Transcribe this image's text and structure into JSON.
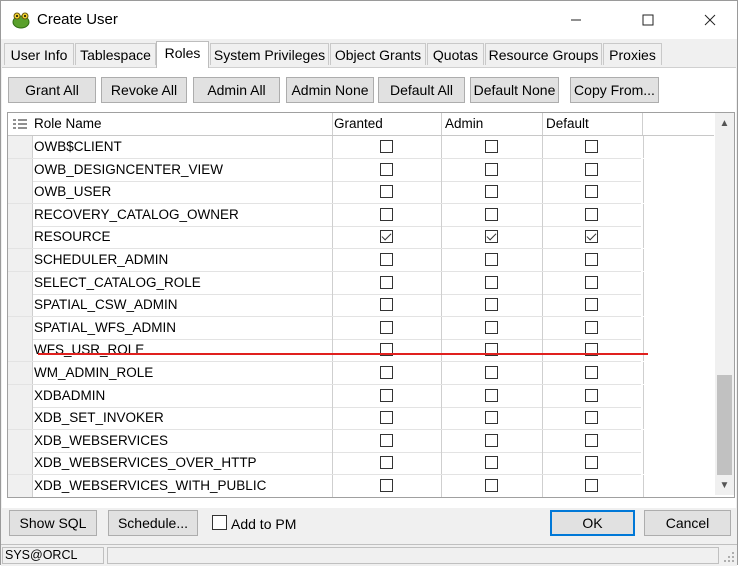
{
  "window": {
    "title": "Create User"
  },
  "tabs": [
    {
      "label": "User Info"
    },
    {
      "label": "Tablespace"
    },
    {
      "label": "Roles"
    },
    {
      "label": "System Privileges"
    },
    {
      "label": "Object Grants"
    },
    {
      "label": "Quotas"
    },
    {
      "label": "Resource Groups"
    },
    {
      "label": "Proxies"
    }
  ],
  "active_tab": "Roles",
  "toolbar": {
    "grant_all": "Grant All",
    "revoke_all": "Revoke All",
    "admin_all": "Admin All",
    "admin_none": "Admin None",
    "default_all": "Default All",
    "default_none": "Default None",
    "copy_from": "Copy From..."
  },
  "grid": {
    "headers": {
      "role_name": "Role Name",
      "granted": "Granted",
      "admin": "Admin",
      "default": "Default"
    },
    "rows": [
      {
        "name": "OWB$CLIENT",
        "granted": false,
        "admin": false,
        "default": false
      },
      {
        "name": "OWB_DESIGNCENTER_VIEW",
        "granted": false,
        "admin": false,
        "default": false
      },
      {
        "name": "OWB_USER",
        "granted": false,
        "admin": false,
        "default": false
      },
      {
        "name": "RECOVERY_CATALOG_OWNER",
        "granted": false,
        "admin": false,
        "default": false
      },
      {
        "name": "RESOURCE",
        "granted": true,
        "admin": true,
        "default": true
      },
      {
        "name": "SCHEDULER_ADMIN",
        "granted": false,
        "admin": false,
        "default": false
      },
      {
        "name": "SELECT_CATALOG_ROLE",
        "granted": false,
        "admin": false,
        "default": false
      },
      {
        "name": "SPATIAL_CSW_ADMIN",
        "granted": false,
        "admin": false,
        "default": false
      },
      {
        "name": "SPATIAL_WFS_ADMIN",
        "granted": false,
        "admin": false,
        "default": false
      },
      {
        "name": "WFS_USR_ROLE",
        "granted": false,
        "admin": false,
        "default": false
      },
      {
        "name": "WM_ADMIN_ROLE",
        "granted": false,
        "admin": false,
        "default": false
      },
      {
        "name": "XDBADMIN",
        "granted": false,
        "admin": false,
        "default": false
      },
      {
        "name": "XDB_SET_INVOKER",
        "granted": false,
        "admin": false,
        "default": false
      },
      {
        "name": "XDB_WEBSERVICES",
        "granted": false,
        "admin": false,
        "default": false
      },
      {
        "name": "XDB_WEBSERVICES_OVER_HTTP",
        "granted": false,
        "admin": false,
        "default": false
      },
      {
        "name": "XDB_WEBSERVICES_WITH_PUBLIC",
        "granted": false,
        "admin": false,
        "default": false
      }
    ]
  },
  "bottom": {
    "show_sql": "Show SQL",
    "schedule": "Schedule...",
    "add_to_pm": "Add to PM",
    "ok": "OK",
    "cancel": "Cancel"
  },
  "status": {
    "connection": "SYS@ORCL",
    "message": ""
  },
  "colors": {
    "highlight_line": "#e0201e",
    "focus_border": "#0078d7"
  }
}
